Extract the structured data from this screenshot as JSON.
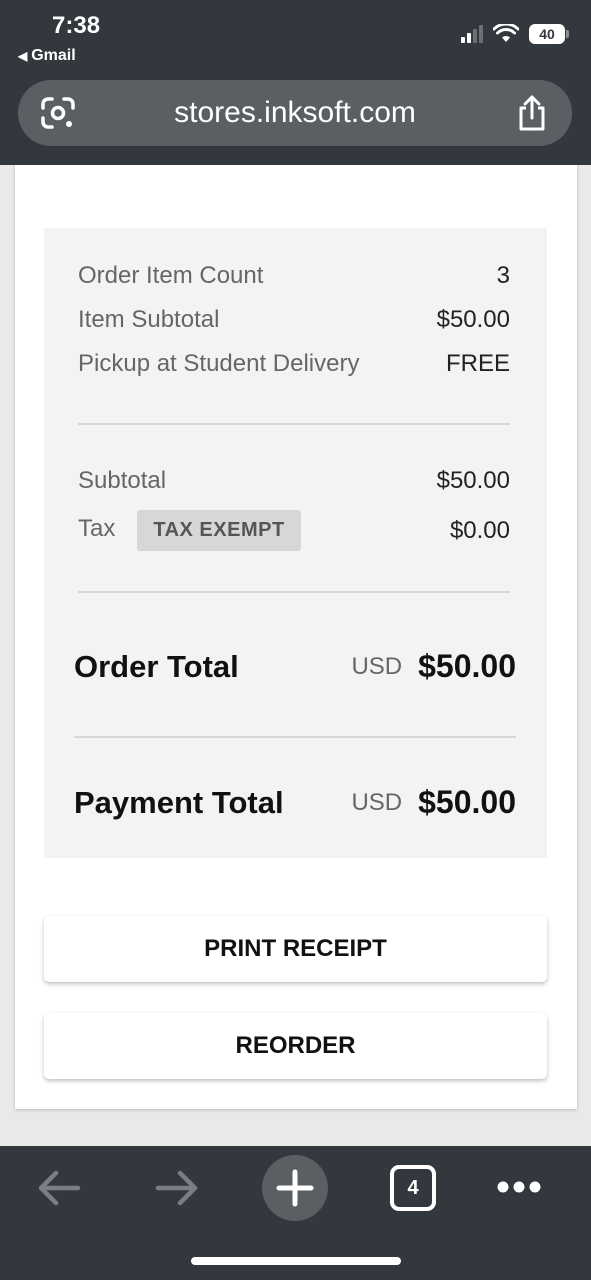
{
  "status_bar": {
    "time": "7:38",
    "back_app": "Gmail",
    "battery": "40"
  },
  "browser": {
    "url": "stores.inksoft.com",
    "tab_count": "4"
  },
  "summary": {
    "item_count_label": "Order Item Count",
    "item_count_value": "3",
    "item_subtotal_label": "Item Subtotal",
    "item_subtotal_value": "$50.00",
    "shipping_label": "Pickup at Student Delivery",
    "shipping_value": "FREE",
    "subtotal_label": "Subtotal",
    "subtotal_value": "$50.00",
    "tax_label": "Tax",
    "tax_badge": "TAX EXEMPT",
    "tax_value": "$0.00",
    "order_total_label": "Order Total",
    "order_total_currency": "USD",
    "order_total_value": "$50.00",
    "payment_total_label": "Payment Total",
    "payment_total_currency": "USD",
    "payment_total_value": "$50.00"
  },
  "actions": {
    "print_receipt": "PRINT RECEIPT",
    "reorder": "REORDER"
  },
  "icons": {
    "lens": "google-lens-icon",
    "share": "share-icon",
    "back": "back-arrow-icon",
    "forward": "forward-arrow-icon",
    "new_tab": "plus-icon",
    "tabs": "tabs-icon",
    "menu": "more-icon"
  }
}
